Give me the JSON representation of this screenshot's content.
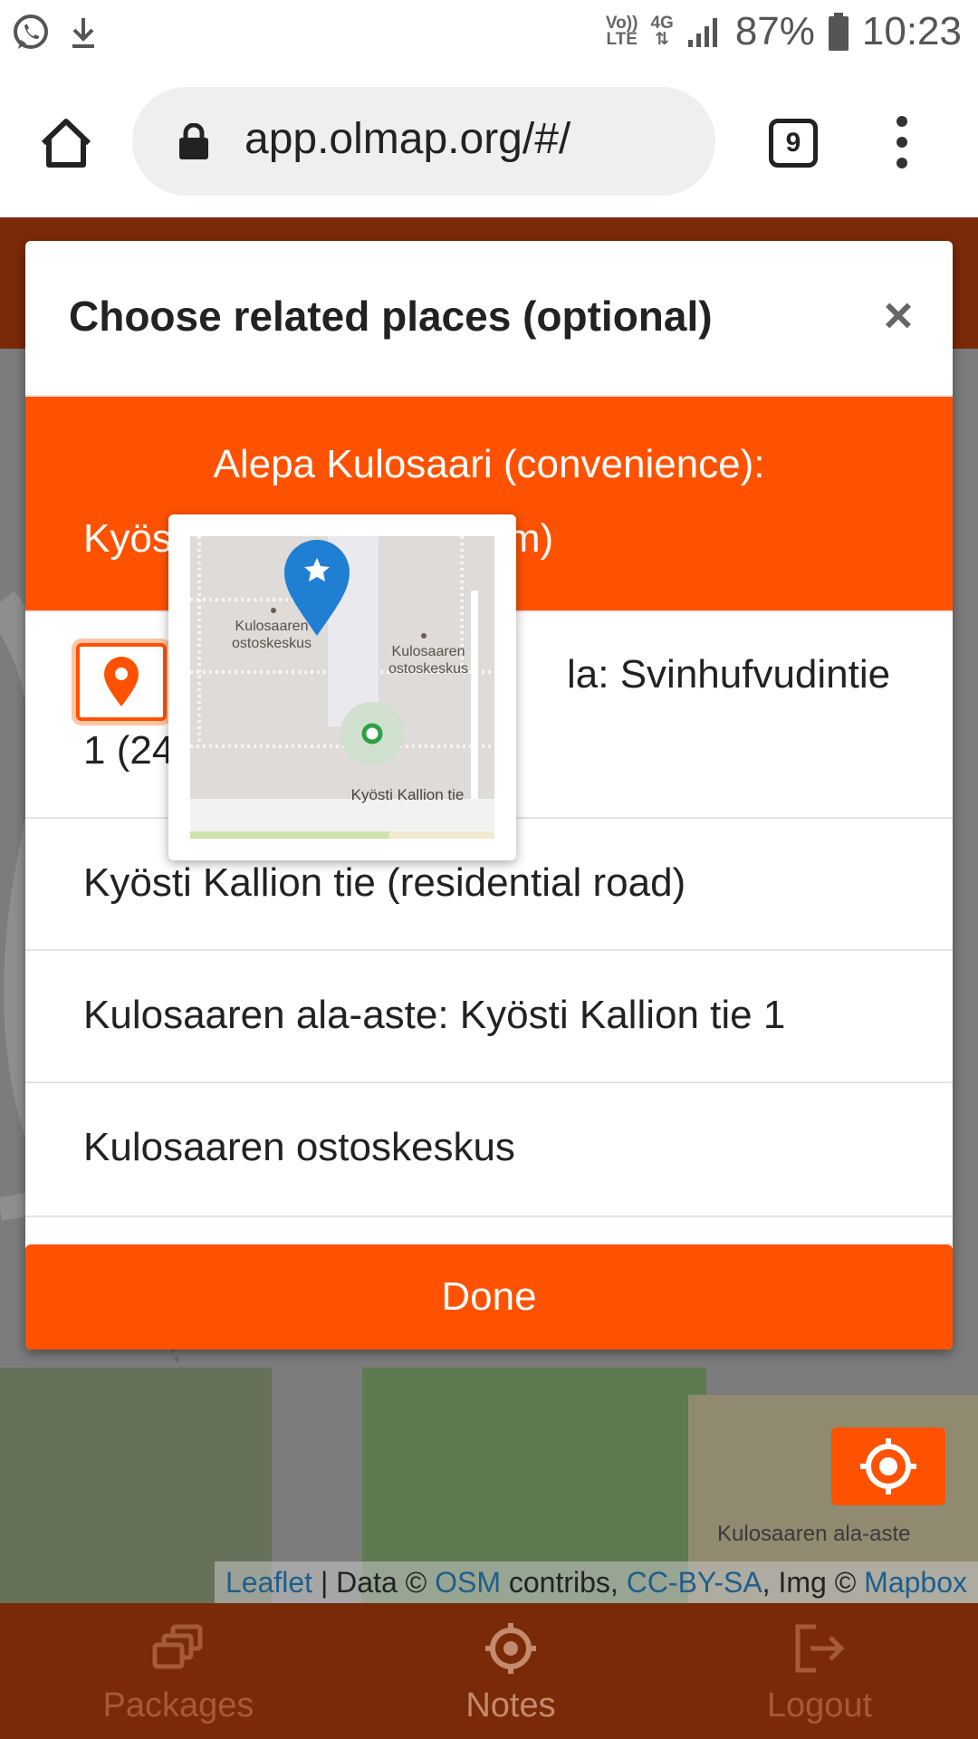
{
  "status_bar": {
    "network_top": "Vo))",
    "network_bottom": "LTE",
    "data_type": "4G",
    "battery": "87%",
    "time": "10:23",
    "icons": [
      "whatsapp-icon",
      "download-icon",
      "signal-icon",
      "battery-icon"
    ]
  },
  "browser": {
    "url": "app.olmap.org/#/",
    "tab_count": "9"
  },
  "modal": {
    "title": "Choose related places (optional)",
    "close_label": "×",
    "selected_item": {
      "line1": "Alepa Kulosaari (convenience):",
      "line2_start": "Kyös",
      "line2_end": "m)"
    },
    "items": [
      {
        "line1_end": "la: Svinhufvudintie",
        "line2_start": "1 (24"
      },
      {
        "label": "Kyösti Kallion tie (residential road)"
      },
      {
        "label": "Kulosaaren ala-aste: Kyösti Kallion tie 1"
      },
      {
        "label": "Kulosaaren ostoskeskus"
      }
    ],
    "done_label": "Done"
  },
  "preview_map": {
    "labels": [
      "Kulosaaren ostoskeskus",
      "Kulosaaren ostoskeskus",
      "Kyösti Kallion tie"
    ]
  },
  "map": {
    "label": "Kulosaaren ala-aste",
    "attribution": {
      "leaflet": "Leaflet",
      "sep1": " | Data © ",
      "osm": "OSM",
      "contribs": " contribs, ",
      "license": "CC-BY-SA",
      "img": ", Img © ",
      "mapbox": "Mapbox"
    }
  },
  "bottom_nav": [
    {
      "label": "Packages",
      "icon": "packages-icon"
    },
    {
      "label": "Notes",
      "icon": "crosshair-icon"
    },
    {
      "label": "Logout",
      "icon": "logout-icon"
    }
  ],
  "colors": {
    "accent": "#fe5200",
    "header": "#7a2a08",
    "pin_blue": "#1e7fd3"
  }
}
